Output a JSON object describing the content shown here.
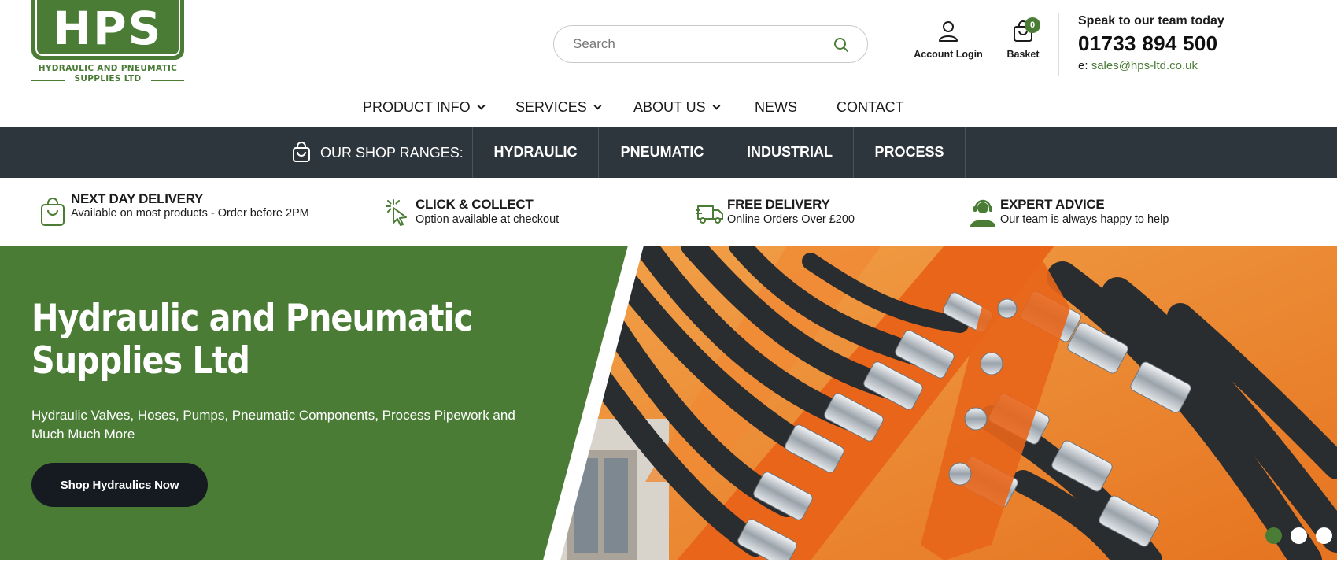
{
  "logo": {
    "letters": "HPS",
    "line1": "HYDRAULIC AND PNEUMATIC",
    "line2": "SUPPLIES LTD"
  },
  "search": {
    "placeholder": "Search"
  },
  "account": {
    "label": "Account Login"
  },
  "basket": {
    "label": "Basket",
    "count": "0"
  },
  "contact": {
    "heading": "Speak to our team today",
    "phone": "01733 894 500",
    "email_prefix": "e:",
    "email": "sales@hps-ltd.co.uk"
  },
  "nav": {
    "items": [
      {
        "label": "PRODUCT INFO",
        "dropdown": true
      },
      {
        "label": "SERVICES",
        "dropdown": true
      },
      {
        "label": "ABOUT US",
        "dropdown": true
      },
      {
        "label": "NEWS",
        "dropdown": false
      },
      {
        "label": "CONTACT",
        "dropdown": false
      }
    ]
  },
  "ranges": {
    "label": "OUR SHOP RANGES:",
    "tabs": [
      "HYDRAULIC",
      "PNEUMATIC",
      "INDUSTRIAL",
      "PROCESS"
    ]
  },
  "usps": [
    {
      "icon": "shopping-bag-icon",
      "title": "NEXT DAY DELIVERY",
      "text": "Available on most products - Order before 2PM"
    },
    {
      "icon": "cursor-click-icon",
      "title": "CLICK & COLLECT",
      "text": "Option available at checkout"
    },
    {
      "icon": "delivery-truck-icon",
      "title": "FREE DELIVERY",
      "text": "Online Orders Over £200"
    },
    {
      "icon": "support-agent-icon",
      "title": "EXPERT ADVICE",
      "text": "Our team is always happy to help"
    }
  ],
  "hero": {
    "title": "Hydraulic and Pneumatic Supplies Ltd",
    "subtitle": "Hydraulic Valves, Hoses, Pumps, Pneumatic Components, Process Pipework and Much Much More",
    "cta": "Shop Hydraulics Now",
    "slides": 3,
    "active_slide": 1
  },
  "colors": {
    "brand_green": "#4a7c36",
    "dark_bar": "#2e363d",
    "cta_dark": "#161b22",
    "photo_orange": "#e8701c"
  }
}
